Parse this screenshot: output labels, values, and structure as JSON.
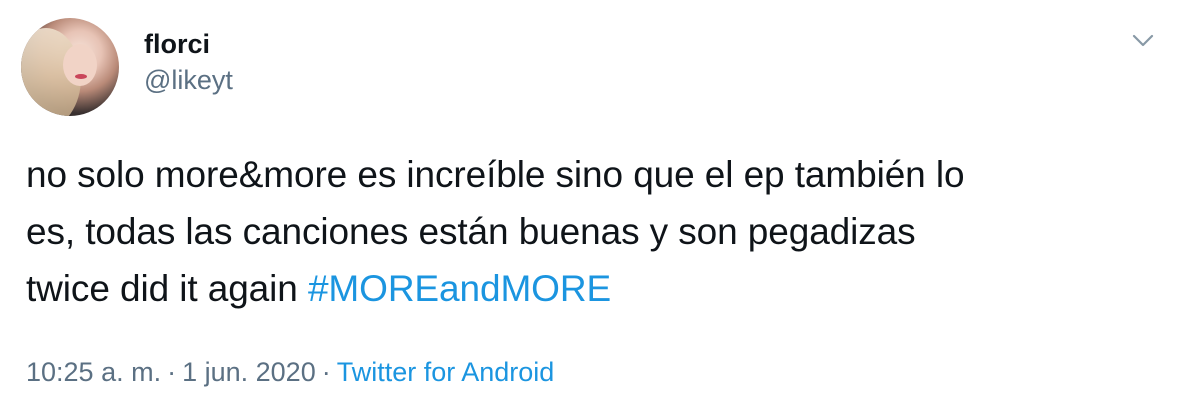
{
  "user": {
    "display_name": "florci",
    "handle": "@likeyt"
  },
  "tweet": {
    "line1": "no solo more&more es increíble sino que el ep también lo",
    "line2": "es, todas las canciones están buenas y son pegadizas",
    "line3_text": "twice did it again ",
    "hashtag": "#MOREandMORE"
  },
  "meta": {
    "time": "10:25 a. m.",
    "separator": "·",
    "date": "1 jun. 2020",
    "source": "Twitter for Android"
  },
  "colors": {
    "text": "#0f1419",
    "secondary": "#5b7083",
    "link": "#1b95e0"
  },
  "icons": {
    "menu": "chevron-down-icon"
  }
}
